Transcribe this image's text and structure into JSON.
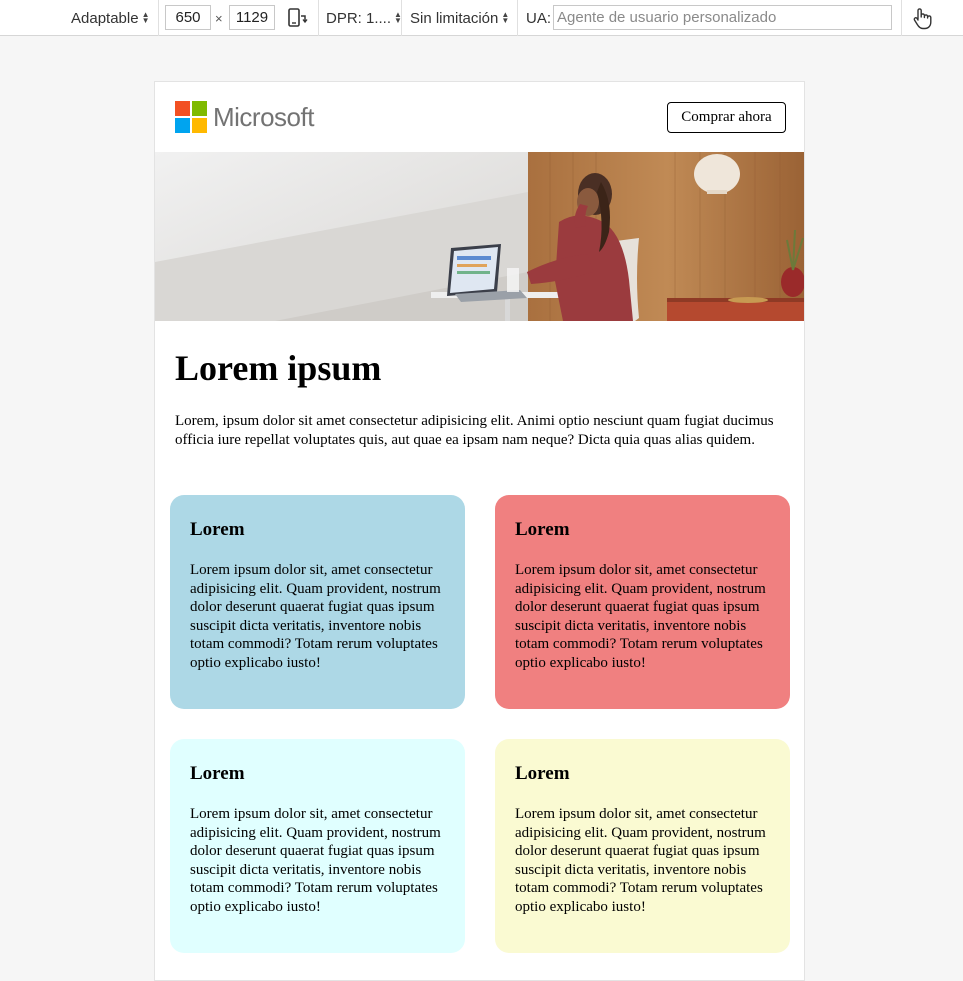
{
  "toolbar": {
    "device_mode": "Adaptable",
    "width": "650",
    "times": "×",
    "height": "1129",
    "dpr": "DPR: 1....",
    "throttle": "Sin limitación",
    "ua_label": "UA:",
    "ua_placeholder": "Agente de usuario personalizado",
    "icons": [
      "rotate-icon",
      "touch-icon"
    ]
  },
  "page": {
    "brand": "Microsoft",
    "buy_button": "Comprar ahora",
    "title": "Lorem ipsum",
    "intro": "Lorem, ipsum dolor sit amet consectetur adipisicing elit. Animi optio nesciunt quam fugiat ducimus officia iure repellat voluptates quis, aut quae ea ipsam nam neque? Dicta quia quas alias quidem.",
    "cards": [
      {
        "title": "Lorem",
        "body": "Lorem ipsum dolor sit, amet consectetur adipisicing elit. Quam provident, nostrum dolor deserunt quaerat fugiat quas ipsum suscipit dicta veritatis, inventore nobis totam commodi? Totam rerum voluptates optio explicabo iusto!",
        "color": "#add8e6"
      },
      {
        "title": "Lorem",
        "body": "Lorem ipsum dolor sit, amet consectetur adipisicing elit. Quam provident, nostrum dolor deserunt quaerat fugiat quas ipsum suscipit dicta veritatis, inventore nobis totam commodi? Totam rerum voluptates optio explicabo iusto!",
        "color": "#f08080"
      },
      {
        "title": "Lorem",
        "body": "Lorem ipsum dolor sit, amet consectetur adipisicing elit. Quam provident, nostrum dolor deserunt quaerat fugiat quas ipsum suscipit dicta veritatis, inventore nobis totam commodi? Totam rerum voluptates optio explicabo iusto!",
        "color": "#e0ffff"
      },
      {
        "title": "Lorem",
        "body": "Lorem ipsum dolor sit, amet consectetur adipisicing elit. Quam provident, nostrum dolor deserunt quaerat fugiat quas ipsum suscipit dicta veritatis, inventore nobis totam commodi? Totam rerum voluptates optio explicabo iusto!",
        "color": "#fafad2"
      }
    ],
    "logo_colors": [
      "#f25022",
      "#7fba00",
      "#00a4ef",
      "#ffb900"
    ]
  }
}
